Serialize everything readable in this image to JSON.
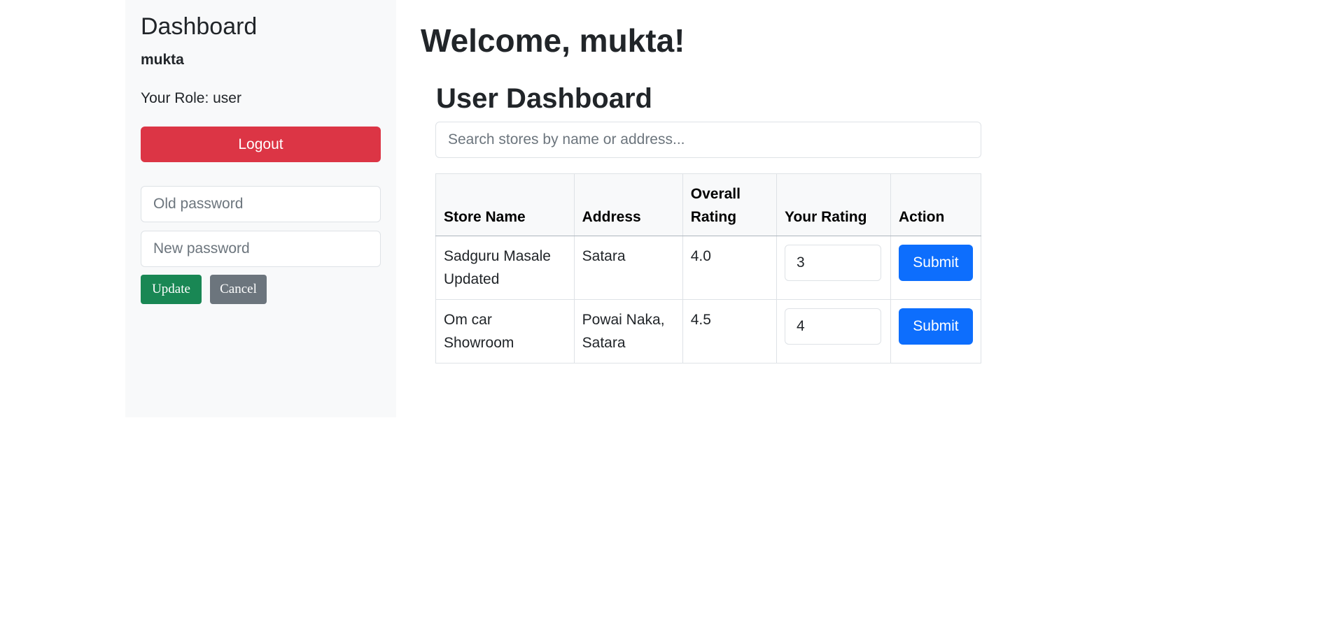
{
  "sidebar": {
    "title": "Dashboard",
    "username": "mukta",
    "role_text": "Your Role: user",
    "logout_label": "Logout",
    "old_password_placeholder": "Old password",
    "new_password_placeholder": "New password",
    "update_label": "Update",
    "cancel_label": "Cancel"
  },
  "main": {
    "welcome": "Welcome, mukta!",
    "dashboard_title": "User Dashboard",
    "search_placeholder": "Search stores by name or address...",
    "table": {
      "headers": [
        "Store Name",
        "Address",
        "Overall Rating",
        "Your Rating",
        "Action"
      ],
      "rows": [
        {
          "name": "Sadguru Masale Updated",
          "address": "Satara",
          "overall": "4.0",
          "your_rating": "3",
          "action": "Submit"
        },
        {
          "name": "Om car Showroom",
          "address": "Powai Naka, Satara",
          "overall": "4.5",
          "your_rating": "4",
          "action": "Submit"
        }
      ]
    }
  },
  "colors": {
    "logout": "#dc3545",
    "update": "#198754",
    "cancel": "#6c757d",
    "submit": "#0d6efd",
    "sidebar_bg": "#f8f9fa"
  }
}
